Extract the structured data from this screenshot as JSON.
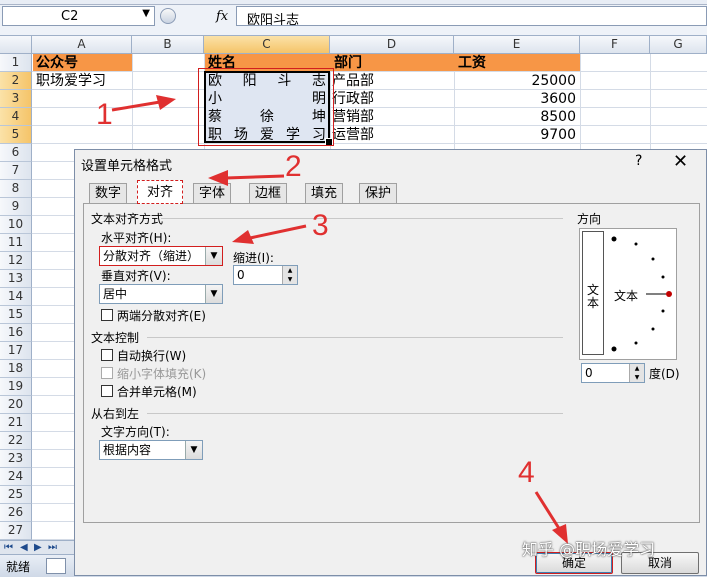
{
  "formula_bar": {
    "name_box": "C2",
    "fx": "fx",
    "value": "欧阳斗志"
  },
  "columns": [
    "A",
    "B",
    "C",
    "D",
    "E",
    "F",
    "G"
  ],
  "rows": [
    "1",
    "2",
    "3",
    "4",
    "5",
    "6",
    "7",
    "8",
    "9",
    "10",
    "11",
    "12",
    "13",
    "14",
    "15",
    "16",
    "17",
    "18",
    "19",
    "20",
    "21",
    "22",
    "23",
    "24",
    "25",
    "26",
    "27"
  ],
  "sheet": {
    "headers": {
      "a": "公众号",
      "c": "姓名",
      "d": "部门",
      "e": "工资"
    },
    "a2": "职场爱学习",
    "names": [
      [
        "欧",
        "阳",
        "斗",
        "志"
      ],
      [
        "小",
        "明"
      ],
      [
        "蔡",
        "徐",
        "坤"
      ],
      [
        "职",
        "场",
        "爱",
        "学",
        "习"
      ]
    ],
    "departments": [
      "产品部",
      "行政部",
      "营销部",
      "运营部"
    ],
    "salaries": [
      "25000",
      "3600",
      "8500",
      "9700"
    ]
  },
  "annotations": [
    "1",
    "2",
    "3",
    "4"
  ],
  "status_bar": {
    "ready": "就绪"
  },
  "dialog": {
    "title": "设置单元格格式",
    "help": "?",
    "close": "✕",
    "tabs": [
      "数字",
      "对齐",
      "字体",
      "边框",
      "填充",
      "保护"
    ],
    "text_align_section": "文本对齐方式",
    "horizontal_label": "水平对齐(H):",
    "horizontal_value": "分散对齐（缩进）",
    "indent_label": "缩进(I):",
    "indent_value": "0",
    "vertical_label": "垂直对齐(V):",
    "vertical_value": "居中",
    "justify_distributed": "两端分散对齐(E)",
    "text_control_section": "文本控制",
    "wrap_text": "自动换行(W)",
    "shrink_to_fit": "缩小字体填充(K)",
    "merge_cells": "合并单元格(M)",
    "rtl_section": "从右到左",
    "text_direction_label": "文字方向(T):",
    "text_direction_value": "根据内容",
    "orientation_label": "方向",
    "orientation_vertical_text": "文本",
    "orientation_text": "文本",
    "degrees_value": "0",
    "degrees_label": "度(D)",
    "ok": "确定",
    "cancel": "取消"
  },
  "watermark": "知乎 @职场爱学习"
}
